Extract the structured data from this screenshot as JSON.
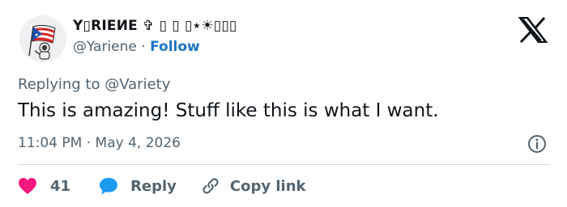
{
  "user": {
    "display_name": "Y▯RIEИE ✞ ▯ ▯ ▯⋆☀▯▯▯",
    "handle": "@Yariene",
    "separator": "·",
    "follow_label": "Follow",
    "avatar_icon": "astronaut-with-puerto-rico-flag"
  },
  "brand": {
    "logo_icon": "x-logo"
  },
  "tweet": {
    "replying_to_prefix": "Replying to",
    "replying_to_handle": "@Variety",
    "text": "This is amazing! Stuff like this is what I want.",
    "timestamp": "11:04 PM · May 4, 2026",
    "info_icon": "info-icon"
  },
  "actions": {
    "like_count": "41",
    "reply_label": "Reply",
    "copy_link_label": "Copy link"
  },
  "colors": {
    "heart": "#f91880",
    "reply_bubble": "#1d9bf0",
    "follow": "#1d74c9",
    "muted": "#536471",
    "divider": "#cfd9de"
  }
}
